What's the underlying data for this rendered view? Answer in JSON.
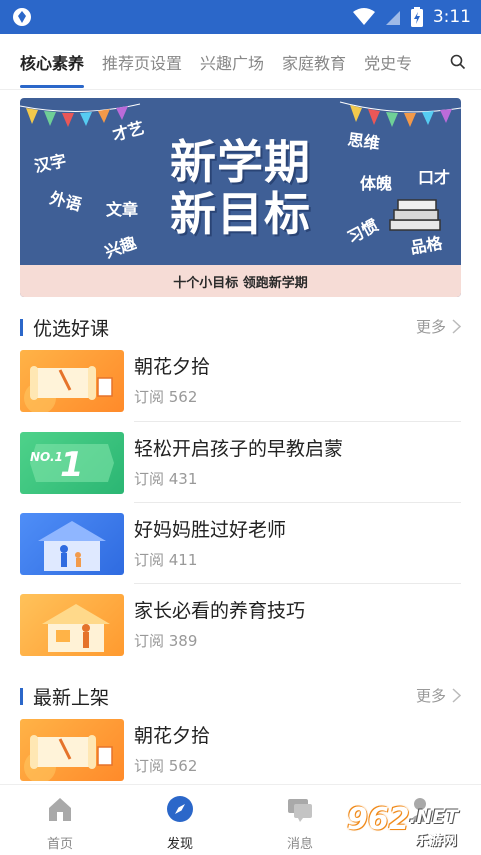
{
  "status": {
    "time": "3:11"
  },
  "tabs": [
    "核心素养",
    "推荐页设置",
    "兴趣广场",
    "家庭教育",
    "党史专"
  ],
  "banner": {
    "title_line1": "新学期",
    "title_line2": "新目标",
    "subtitle": "十个小目标 领跑新学期",
    "words": [
      "才艺",
      "汉字",
      "外语",
      "文章",
      "兴趣",
      "思维",
      "体魄",
      "口才",
      "习惯",
      "品格"
    ]
  },
  "sections": {
    "featured": {
      "title": "优选好课",
      "more": "更多",
      "courses": [
        {
          "title": "朝花夕拾",
          "sub": "订阅 562"
        },
        {
          "title": "轻松开启孩子的早教启蒙",
          "sub": "订阅 431",
          "badge": "NO.1"
        },
        {
          "title": "好妈妈胜过好老师",
          "sub": "订阅 411"
        },
        {
          "title": "家长必看的养育技巧",
          "sub": "订阅 389"
        }
      ]
    },
    "latest": {
      "title": "最新上架",
      "more": "更多",
      "courses": [
        {
          "title": "朝花夕拾",
          "sub": "订阅 562"
        }
      ]
    }
  },
  "nav": [
    {
      "label": "首页",
      "icon": "home-icon"
    },
    {
      "label": "发现",
      "icon": "compass-icon"
    },
    {
      "label": "消息",
      "icon": "message-icon"
    },
    {
      "label": "",
      "icon": "profile-icon"
    }
  ],
  "watermark": {
    "number": "962",
    "suffix": ".NET",
    "site": "乐游网"
  },
  "colors": {
    "accent": "#2b67c9",
    "banner": "#3f5f96"
  }
}
